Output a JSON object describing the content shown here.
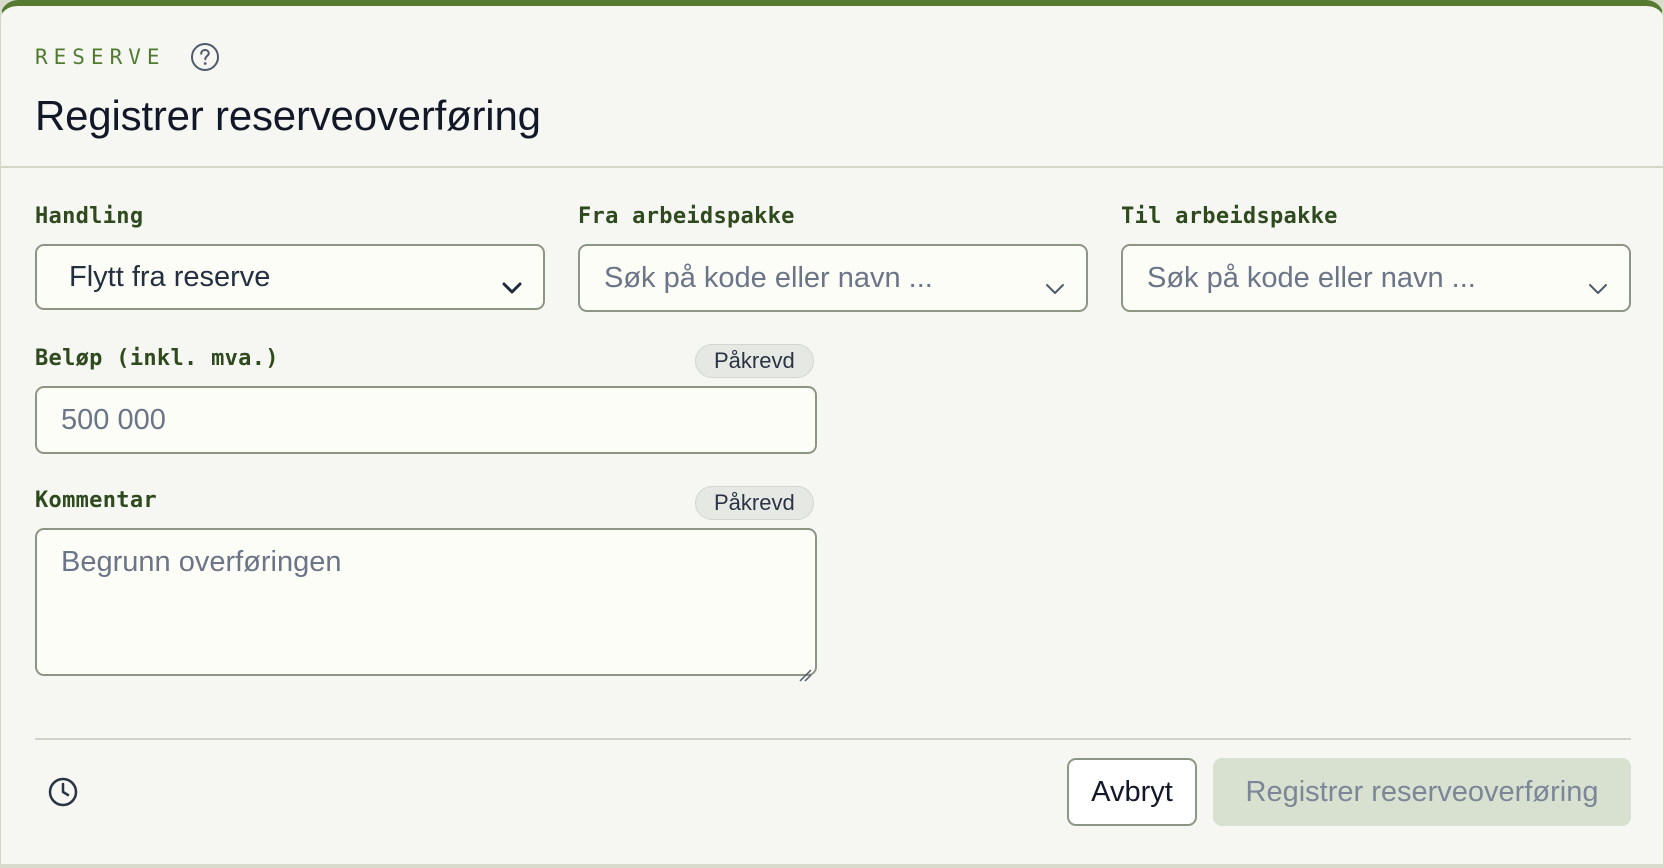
{
  "header": {
    "eyebrow": "RESERVE",
    "title": "Registrer reserveoverføring",
    "help_icon": "question-circle-icon"
  },
  "form": {
    "handling": {
      "label": "Handling",
      "value": "Flytt fra reserve"
    },
    "fra": {
      "label": "Fra arbeidspakke",
      "placeholder": "Søk på kode eller navn ..."
    },
    "til": {
      "label": "Til arbeidspakke",
      "placeholder": "Søk på kode eller navn ..."
    },
    "belop": {
      "label": "Beløp (inkl. mva.)",
      "badge": "Påkrevd",
      "placeholder": "500 000"
    },
    "kommentar": {
      "label": "Kommentar",
      "badge": "Påkrevd",
      "placeholder": "Begrunn overføringen"
    }
  },
  "footer": {
    "history_icon": "clock-icon",
    "cancel_label": "Avbryt",
    "submit_label": "Registrer reserveoverføring"
  },
  "colors": {
    "accent": "#567a2f",
    "label": "#2f4a1e",
    "submit_disabled_bg": "#d8e0cf"
  }
}
